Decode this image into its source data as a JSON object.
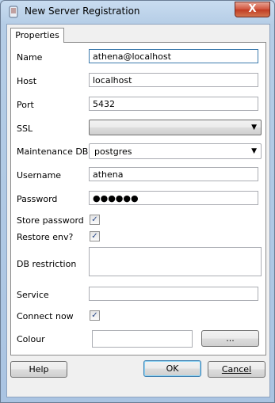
{
  "window": {
    "title": "New Server Registration",
    "close_label": "X"
  },
  "tabs": [
    {
      "label": "Properties"
    }
  ],
  "form": {
    "name": {
      "label": "Name",
      "value": "athena@localhost"
    },
    "host": {
      "label": "Host",
      "value": "localhost"
    },
    "port": {
      "label": "Port",
      "value": "5432"
    },
    "ssl": {
      "label": "SSL",
      "value": ""
    },
    "maintenance_db": {
      "label": "Maintenance DB",
      "value": "postgres"
    },
    "username": {
      "label": "Username",
      "value": "athena"
    },
    "password": {
      "label": "Password",
      "value": "●●●●●●"
    },
    "store_password": {
      "label": "Store password",
      "checked": true
    },
    "restore_env": {
      "label": "Restore env?",
      "checked": true
    },
    "db_restriction": {
      "label": "DB restriction",
      "value": ""
    },
    "service": {
      "label": "Service",
      "value": ""
    },
    "connect_now": {
      "label": "Connect now",
      "checked": true
    },
    "colour": {
      "label": "Colour",
      "value": "",
      "button_label": "..."
    }
  },
  "buttons": {
    "help": "Help",
    "ok": "OK",
    "cancel": "Cancel"
  },
  "check_glyph": "✓"
}
